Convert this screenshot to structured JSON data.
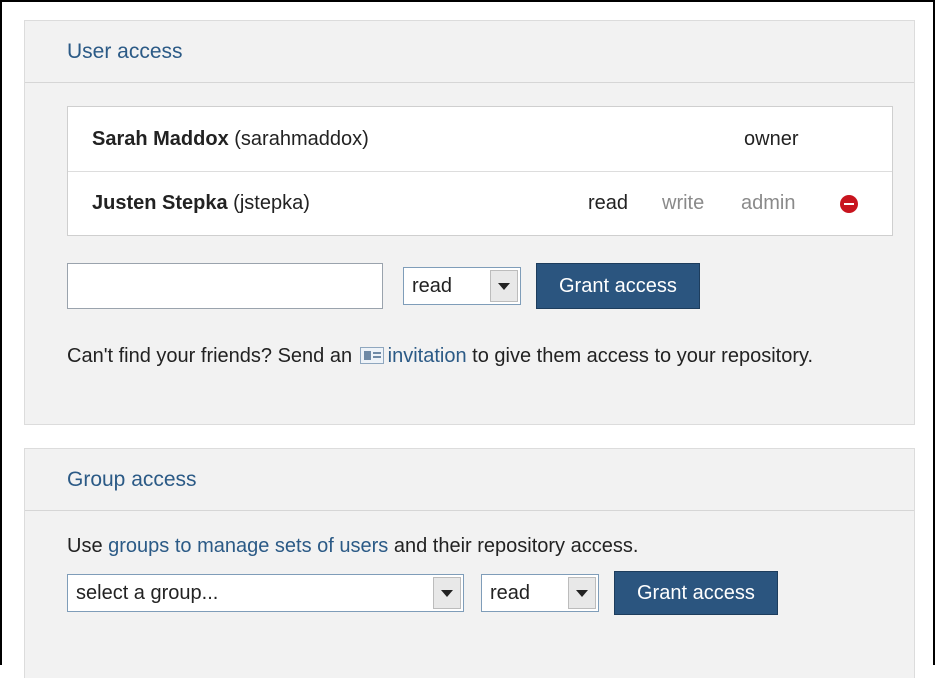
{
  "user_access": {
    "title": "User access",
    "users": [
      {
        "name": "Sarah Maddox",
        "username": "(sarahmaddox)",
        "role": "owner"
      },
      {
        "name": "Justen Stepka",
        "username": "(jstepka)",
        "perms": {
          "read": "read",
          "write": "write",
          "admin": "admin"
        },
        "active": "read",
        "remove_icon": "remove-icon"
      }
    ],
    "input_value": "",
    "permission_select": "read",
    "grant_button": "Grant access",
    "invite": {
      "text_before": "Can't find your friends? Send an",
      "link": "invitation",
      "text_after": "to give them access to your repository.",
      "icon": "contact-card-icon"
    }
  },
  "group_access": {
    "title": "Group access",
    "text_before": "Use",
    "link": "groups to manage sets of users",
    "text_after": "and their repository access.",
    "group_select": "select a group...",
    "permission_select": "read",
    "grant_button": "Grant access"
  }
}
